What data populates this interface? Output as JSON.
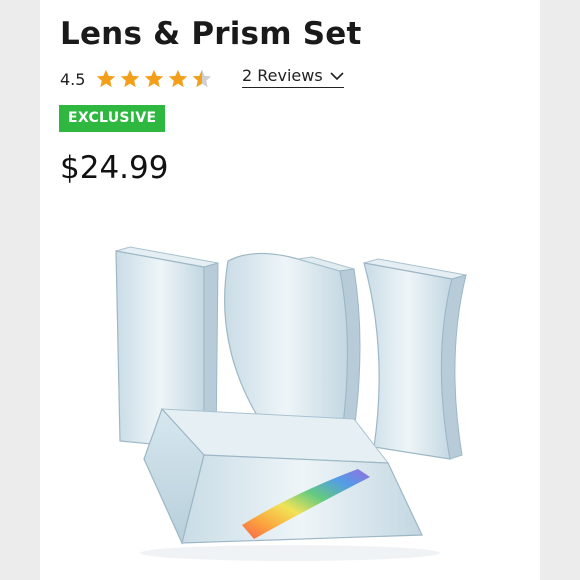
{
  "product": {
    "title": "Lens & Prism Set",
    "rating": "4.5",
    "rating_value": 4.5,
    "rating_max": 5,
    "reviews_label": "2 Reviews",
    "badge": "EXCLUSIVE",
    "price": "$24.99",
    "image_name": "lens-and-prism-set-photo"
  },
  "colors": {
    "star": "#f2a01c",
    "star_empty": "#cfcfcf",
    "badge_bg": "#2eb840",
    "text": "#1a1a1a"
  }
}
